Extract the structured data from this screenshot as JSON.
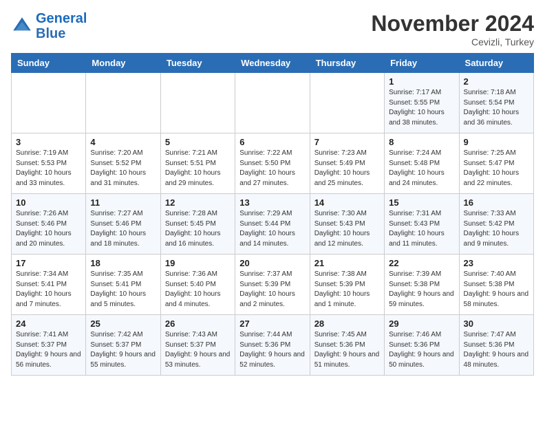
{
  "header": {
    "logo_line1": "General",
    "logo_line2": "Blue",
    "month": "November 2024",
    "location": "Cevizli, Turkey"
  },
  "days_of_week": [
    "Sunday",
    "Monday",
    "Tuesday",
    "Wednesday",
    "Thursday",
    "Friday",
    "Saturday"
  ],
  "weeks": [
    [
      {
        "num": "",
        "info": ""
      },
      {
        "num": "",
        "info": ""
      },
      {
        "num": "",
        "info": ""
      },
      {
        "num": "",
        "info": ""
      },
      {
        "num": "",
        "info": ""
      },
      {
        "num": "1",
        "info": "Sunrise: 7:17 AM\nSunset: 5:55 PM\nDaylight: 10 hours and 38 minutes."
      },
      {
        "num": "2",
        "info": "Sunrise: 7:18 AM\nSunset: 5:54 PM\nDaylight: 10 hours and 36 minutes."
      }
    ],
    [
      {
        "num": "3",
        "info": "Sunrise: 7:19 AM\nSunset: 5:53 PM\nDaylight: 10 hours and 33 minutes."
      },
      {
        "num": "4",
        "info": "Sunrise: 7:20 AM\nSunset: 5:52 PM\nDaylight: 10 hours and 31 minutes."
      },
      {
        "num": "5",
        "info": "Sunrise: 7:21 AM\nSunset: 5:51 PM\nDaylight: 10 hours and 29 minutes."
      },
      {
        "num": "6",
        "info": "Sunrise: 7:22 AM\nSunset: 5:50 PM\nDaylight: 10 hours and 27 minutes."
      },
      {
        "num": "7",
        "info": "Sunrise: 7:23 AM\nSunset: 5:49 PM\nDaylight: 10 hours and 25 minutes."
      },
      {
        "num": "8",
        "info": "Sunrise: 7:24 AM\nSunset: 5:48 PM\nDaylight: 10 hours and 24 minutes."
      },
      {
        "num": "9",
        "info": "Sunrise: 7:25 AM\nSunset: 5:47 PM\nDaylight: 10 hours and 22 minutes."
      }
    ],
    [
      {
        "num": "10",
        "info": "Sunrise: 7:26 AM\nSunset: 5:46 PM\nDaylight: 10 hours and 20 minutes."
      },
      {
        "num": "11",
        "info": "Sunrise: 7:27 AM\nSunset: 5:46 PM\nDaylight: 10 hours and 18 minutes."
      },
      {
        "num": "12",
        "info": "Sunrise: 7:28 AM\nSunset: 5:45 PM\nDaylight: 10 hours and 16 minutes."
      },
      {
        "num": "13",
        "info": "Sunrise: 7:29 AM\nSunset: 5:44 PM\nDaylight: 10 hours and 14 minutes."
      },
      {
        "num": "14",
        "info": "Sunrise: 7:30 AM\nSunset: 5:43 PM\nDaylight: 10 hours and 12 minutes."
      },
      {
        "num": "15",
        "info": "Sunrise: 7:31 AM\nSunset: 5:43 PM\nDaylight: 10 hours and 11 minutes."
      },
      {
        "num": "16",
        "info": "Sunrise: 7:33 AM\nSunset: 5:42 PM\nDaylight: 10 hours and 9 minutes."
      }
    ],
    [
      {
        "num": "17",
        "info": "Sunrise: 7:34 AM\nSunset: 5:41 PM\nDaylight: 10 hours and 7 minutes."
      },
      {
        "num": "18",
        "info": "Sunrise: 7:35 AM\nSunset: 5:41 PM\nDaylight: 10 hours and 5 minutes."
      },
      {
        "num": "19",
        "info": "Sunrise: 7:36 AM\nSunset: 5:40 PM\nDaylight: 10 hours and 4 minutes."
      },
      {
        "num": "20",
        "info": "Sunrise: 7:37 AM\nSunset: 5:39 PM\nDaylight: 10 hours and 2 minutes."
      },
      {
        "num": "21",
        "info": "Sunrise: 7:38 AM\nSunset: 5:39 PM\nDaylight: 10 hours and 1 minute."
      },
      {
        "num": "22",
        "info": "Sunrise: 7:39 AM\nSunset: 5:38 PM\nDaylight: 9 hours and 59 minutes."
      },
      {
        "num": "23",
        "info": "Sunrise: 7:40 AM\nSunset: 5:38 PM\nDaylight: 9 hours and 58 minutes."
      }
    ],
    [
      {
        "num": "24",
        "info": "Sunrise: 7:41 AM\nSunset: 5:37 PM\nDaylight: 9 hours and 56 minutes."
      },
      {
        "num": "25",
        "info": "Sunrise: 7:42 AM\nSunset: 5:37 PM\nDaylight: 9 hours and 55 minutes."
      },
      {
        "num": "26",
        "info": "Sunrise: 7:43 AM\nSunset: 5:37 PM\nDaylight: 9 hours and 53 minutes."
      },
      {
        "num": "27",
        "info": "Sunrise: 7:44 AM\nSunset: 5:36 PM\nDaylight: 9 hours and 52 minutes."
      },
      {
        "num": "28",
        "info": "Sunrise: 7:45 AM\nSunset: 5:36 PM\nDaylight: 9 hours and 51 minutes."
      },
      {
        "num": "29",
        "info": "Sunrise: 7:46 AM\nSunset: 5:36 PM\nDaylight: 9 hours and 50 minutes."
      },
      {
        "num": "30",
        "info": "Sunrise: 7:47 AM\nSunset: 5:36 PM\nDaylight: 9 hours and 48 minutes."
      }
    ]
  ]
}
